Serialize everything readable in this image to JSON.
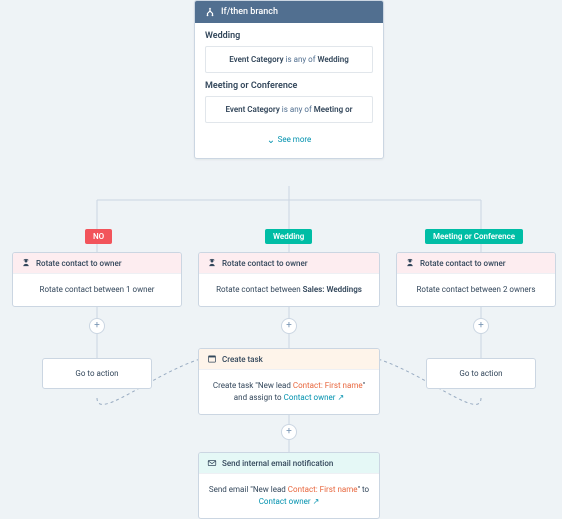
{
  "branch": {
    "title": "If/then branch",
    "groups": [
      {
        "name": "Wedding",
        "field": "Event Category",
        "op": "is any of",
        "value": "Wedding"
      },
      {
        "name": "Meeting or Conference",
        "field": "Event Category",
        "op": "is any of",
        "value": "Meeting or"
      }
    ],
    "seeMore": "See more"
  },
  "badges": {
    "no": "NO",
    "wedding": "Wedding",
    "meeting": "Meeting or Conference"
  },
  "cards": {
    "rotateTitle": "Rotate contact to owner",
    "rotateLeft": "Rotate contact between 1 owner",
    "rotateMidPre": "Rotate contact between ",
    "rotateMidBold": "Sales: Weddings",
    "rotateRight": "Rotate contact between 2 owners",
    "goto": "Go to action",
    "createTaskTitle": "Create task",
    "createTaskLine1a": "Create task \"New lead ",
    "createTaskToken": "Contact: First name",
    "createTaskLine1b": "\"",
    "createTaskLine2a": "and assign to ",
    "createTaskLink": "Contact owner",
    "emailTitle": "Send internal email notification",
    "emailLine1a": "Send email \"New lead ",
    "emailLine1b": "\" to"
  },
  "colors": {
    "teal": "#00bda5",
    "red": "#f2545b",
    "link": "#0091ae",
    "token": "#e8663d"
  }
}
